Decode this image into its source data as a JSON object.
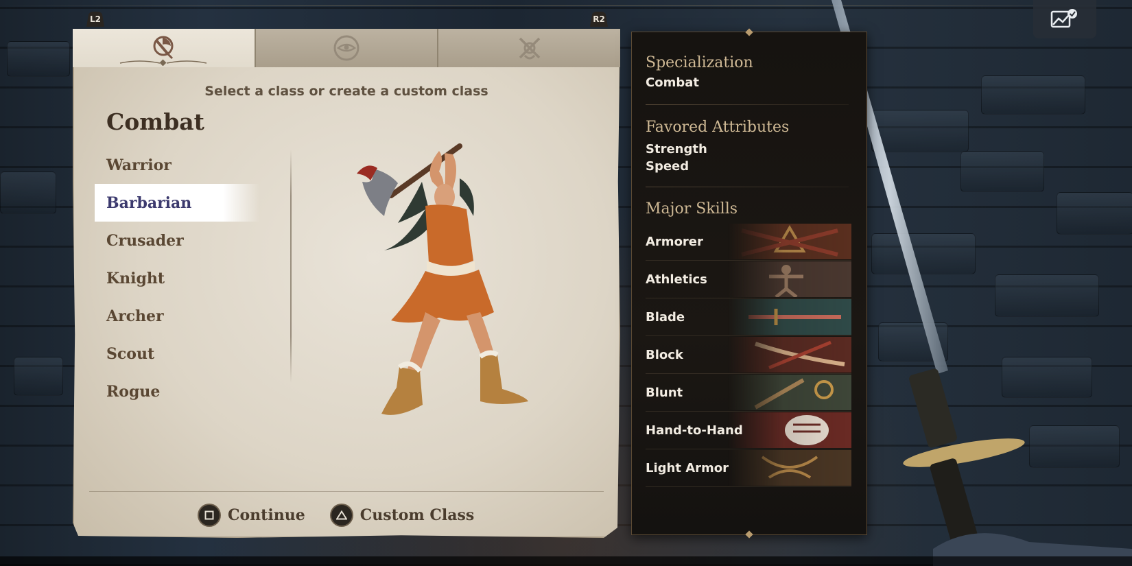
{
  "header": {
    "tabs": [
      {
        "name": "combat",
        "icon": "axe-crest-icon",
        "active": true
      },
      {
        "name": "magic",
        "icon": "eye-sigil-icon",
        "active": false
      },
      {
        "name": "stealth",
        "icon": "crossed-daggers-icon",
        "active": false
      }
    ],
    "left_shoulder": "L2",
    "right_shoulder": "R2"
  },
  "class_select": {
    "prompt": "Select a class or create a custom class",
    "category": "Combat",
    "classes": [
      {
        "label": "Warrior",
        "selected": false
      },
      {
        "label": "Barbarian",
        "selected": true
      },
      {
        "label": "Crusader",
        "selected": false
      },
      {
        "label": "Knight",
        "selected": false
      },
      {
        "label": "Archer",
        "selected": false
      },
      {
        "label": "Scout",
        "selected": false
      },
      {
        "label": "Rogue",
        "selected": false
      }
    ]
  },
  "footer": {
    "continue": {
      "icon": "square-button-icon",
      "label": "Continue"
    },
    "custom_class": {
      "icon": "triangle-button-icon",
      "label": "Custom Class"
    }
  },
  "info": {
    "specialization_label": "Specialization",
    "specialization": "Combat",
    "favored_attributes_label": "Favored Attributes",
    "favored_attributes": [
      "Strength",
      "Speed"
    ],
    "major_skills_label": "Major Skills",
    "major_skills": [
      "Armorer",
      "Athletics",
      "Blade",
      "Block",
      "Blunt",
      "Hand-to-Hand",
      "Light Armor"
    ]
  },
  "colors": {
    "parchment": "#e6dfd3",
    "selected_text": "#3c3a6e",
    "info_heading": "#cfb995",
    "info_bg": "#181410"
  },
  "overlay": {
    "icon": "screenshot-check-icon"
  }
}
